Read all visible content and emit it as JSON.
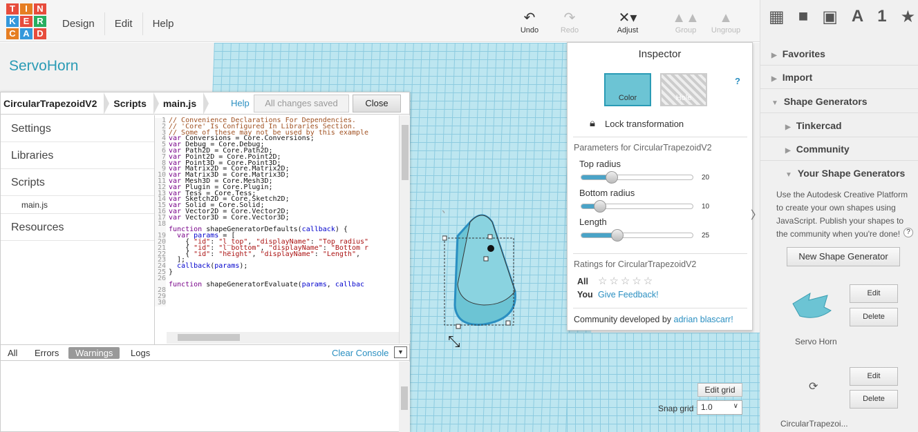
{
  "logo": {
    "letters": [
      "T",
      "I",
      "N",
      "K",
      "E",
      "R",
      "C",
      "A",
      "D"
    ],
    "colors": [
      "#e74c3c",
      "#e67e22",
      "#e74c3c",
      "#3498db",
      "#e74c3c",
      "#27ae60",
      "#e67e22",
      "#3498db",
      "#e74c3c"
    ]
  },
  "menu": [
    "Design",
    "Edit",
    "Help"
  ],
  "toolbar": {
    "undo": "Undo",
    "redo": "Redo",
    "adjust": "Adjust",
    "group": "Group",
    "ungroup": "Ungroup"
  },
  "project_name": "ServoHorn",
  "editor": {
    "crumbs": [
      "CircularTrapezoidV2",
      "Scripts",
      "main.js"
    ],
    "help": "Help",
    "saved": "All changes saved",
    "close": "Close",
    "nav": [
      "Settings",
      "Libraries",
      "Scripts",
      "main.js",
      "Resources"
    ],
    "console_tabs": [
      "All",
      "Errors",
      "Warnings",
      "Logs"
    ],
    "clear_console": "Clear Console"
  },
  "inspector": {
    "title": "Inspector",
    "color_label": "Color",
    "hole_label": "Hole",
    "help": "?",
    "lock": "Lock transformation",
    "params_title": "Parameters for CircularTrapezoidV2",
    "params": [
      {
        "label": "Top radius",
        "value": "20",
        "fraction": 0.2
      },
      {
        "label": "Bottom radius",
        "value": "10",
        "fraction": 0.1
      },
      {
        "label": "Length",
        "value": "25",
        "fraction": 0.25
      }
    ],
    "ratings_title": "Ratings for CircularTrapezoidV2",
    "all_label": "All",
    "you_label": "You",
    "feedback": "Give Feedback!",
    "community_prefix": "Community developed by",
    "author": "adrian blascarr!"
  },
  "right_panel": {
    "favorites": "Favorites",
    "import": "Import",
    "shape_generators": "Shape Generators",
    "tinkercad": "Tinkercad",
    "community": "Community",
    "your_generators": "Your Shape Generators",
    "desc": "Use the Autodesk Creative Platform to create your own shapes using JavaScript. Publish your shapes to the community when you're done!",
    "help": "?",
    "new_button": "New Shape Generator",
    "edit": "Edit",
    "delete": "Delete",
    "item1_name": "Servo Horn",
    "item2_name": "CircularTrapezoi..."
  },
  "grid": {
    "edit_grid": "Edit grid",
    "snap_label": "Snap grid",
    "snap_value": "1.0"
  },
  "colors": {
    "accent": "#2a9bb5",
    "shape": "#6cc4d4",
    "link": "#2a8fc1"
  }
}
